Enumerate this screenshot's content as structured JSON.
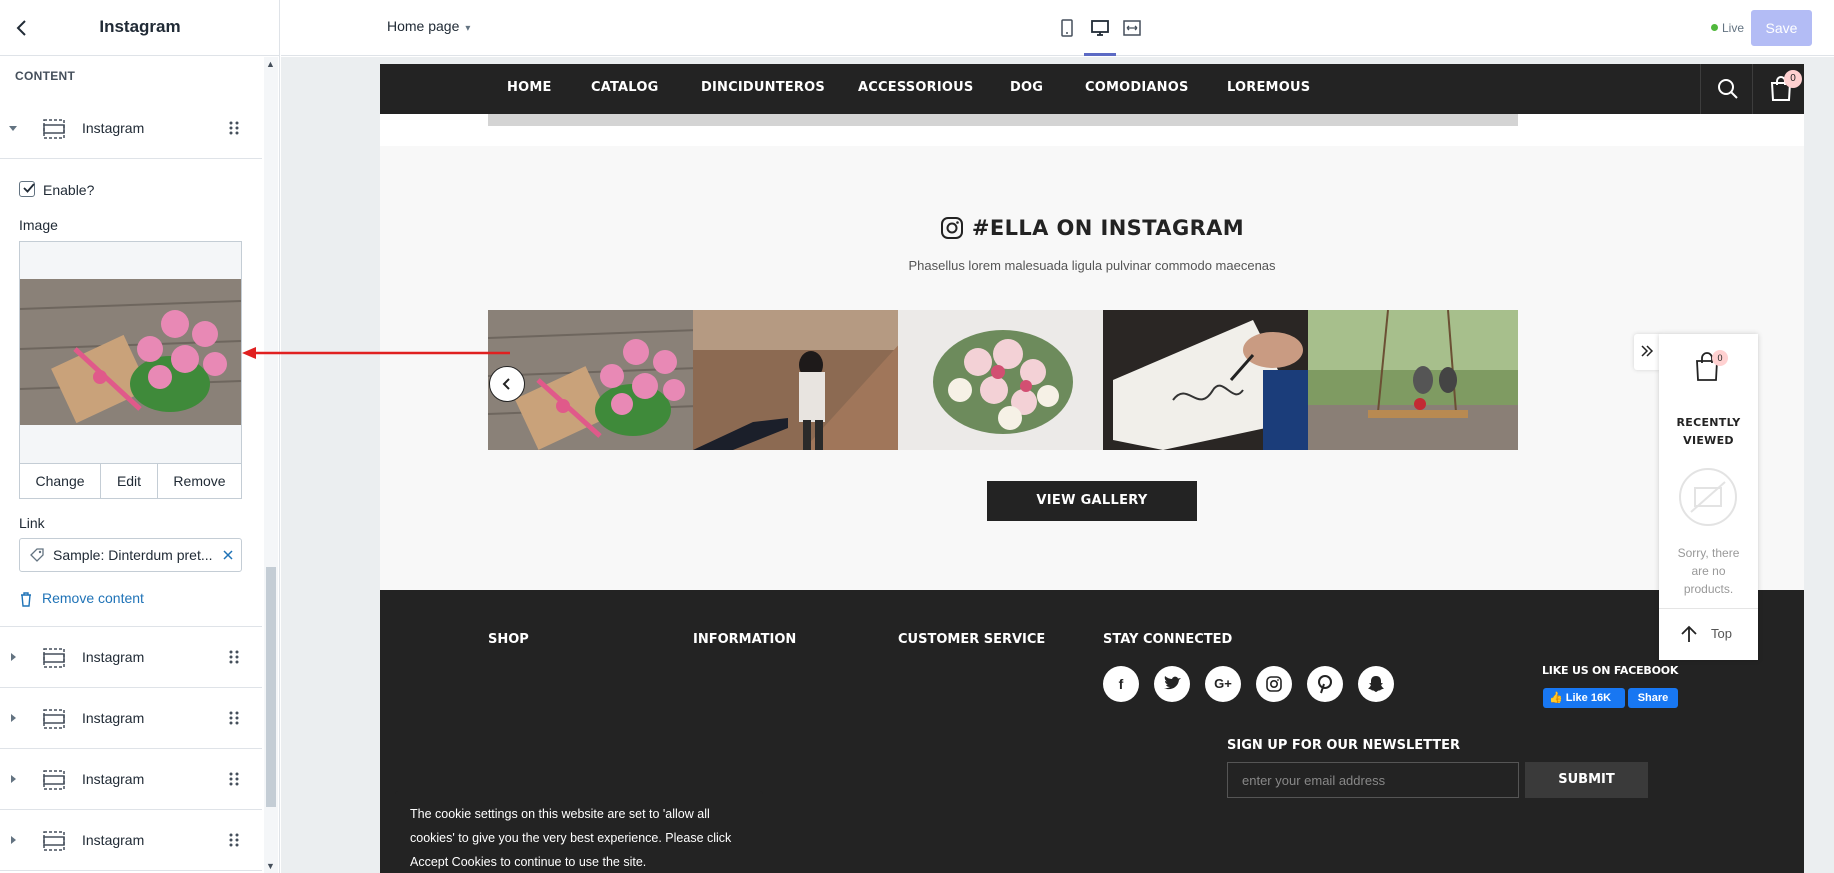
{
  "sidebar": {
    "title": "Instagram",
    "section_label": "CONTENT",
    "expanded_block": {
      "label": "Instagram",
      "enable_label": "Enable?",
      "enable_checked": true,
      "image_label": "Image",
      "image_actions": [
        "Change",
        "Edit",
        "Remove"
      ],
      "link_label": "Link",
      "link_value": "Sample: Dinterdum pret...",
      "remove_label": "Remove content"
    },
    "collapsed_blocks": [
      "Instagram",
      "Instagram",
      "Instagram",
      "Instagram"
    ]
  },
  "topbar": {
    "page_selector": "Home page",
    "devices": [
      "mobile-icon",
      "desktop-icon",
      "fullwidth-icon"
    ],
    "active_device": "desktop",
    "status": "Live",
    "save_label": "Save"
  },
  "store": {
    "nav": [
      "HOME",
      "CATALOG",
      "DINCIDUNTEROS",
      "ACCESSORIOUS",
      "DOG",
      "COMODIANOS",
      "LOREMOUS"
    ],
    "cart_count": "0",
    "instagram": {
      "title": "#ELLA ON INSTAGRAM",
      "subtitle": "Phasellus lorem malesuada ligula pulvinar commodo maecenas",
      "images": [
        "roses-and-gift-photo",
        "holding-hands-cliff-photo",
        "rose-bouquet-photo",
        "handwriting-notebook-photo",
        "wooden-swing-photo"
      ],
      "button": "VIEW GALLERY"
    },
    "footer": {
      "headings": [
        "SHOP",
        "INFORMATION",
        "CUSTOMER SERVICE",
        "STAY CONNECTED"
      ],
      "social": [
        "facebook-icon",
        "twitter-icon",
        "google-plus-icon",
        "instagram-icon",
        "pinterest-icon",
        "snapchat-icon"
      ],
      "facebook_label": "LIKE US ON FACEBOOK",
      "like_label": "Like 16K",
      "share_label": "Share",
      "newsletter_heading": "SIGN UP FOR OUR NEWSLETTER",
      "email_placeholder": "enter your email address",
      "submit_label": "SUBMIT"
    },
    "cookie_text": "The cookie settings on this website are set to 'allow all cookies' to give you the very best experience. Please click Accept Cookies to continue to use the site."
  },
  "recently_viewed": {
    "count": "0",
    "title_line1": "RECENTLY",
    "title_line2": "VIEWED",
    "empty_line1": "Sorry, there",
    "empty_line2": "are no",
    "empty_line3": "products.",
    "top_label": "Top"
  },
  "colors": {
    "accent": "#5c6ac4",
    "save_disabled": "#b3bcf5",
    "store_dark": "#232323",
    "annotation_arrow": "#e02020",
    "link_blue": "#1f73b7"
  }
}
